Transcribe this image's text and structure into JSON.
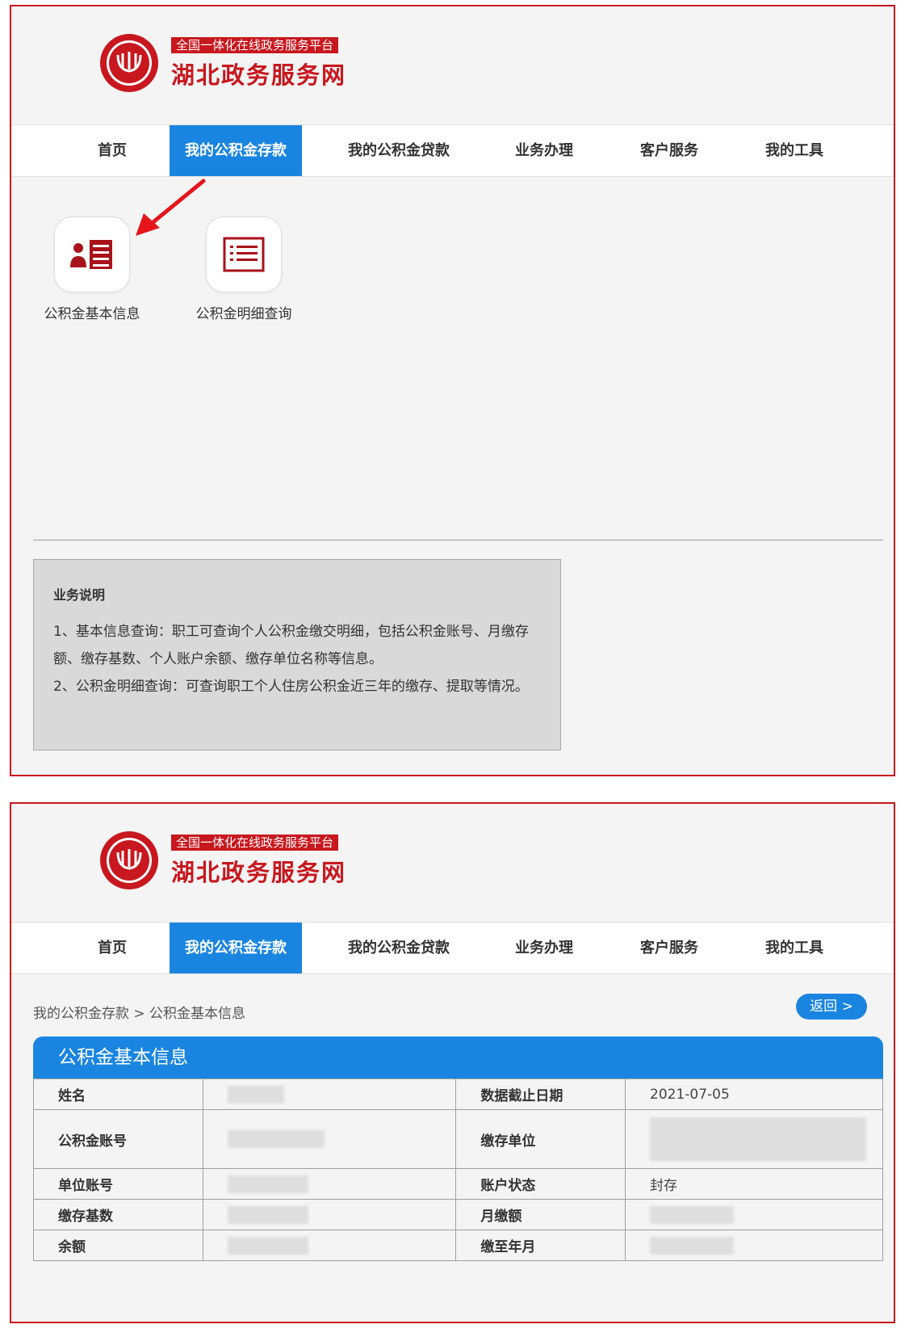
{
  "header": {
    "platform_tag": "全国一体化在线政务服务平台",
    "site_title": "湖北政务服务网"
  },
  "nav": [
    {
      "label": "首页",
      "active": false
    },
    {
      "label": "我的公积金存款",
      "active": true
    },
    {
      "label": "我的公积金贷款",
      "active": false
    },
    {
      "label": "业务办理",
      "active": false
    },
    {
      "label": "客户服务",
      "active": false
    },
    {
      "label": "我的工具",
      "active": false
    }
  ],
  "services": [
    {
      "label": "公积金基本信息",
      "icon": "person-card-icon"
    },
    {
      "label": "公积金明细查询",
      "icon": "list-detail-icon"
    }
  ],
  "notes": {
    "title": "业务说明",
    "line1": "1、基本信息查询：职工可查询个人公积金缴交明细，包括公积金账号、月缴存",
    "line2": "额、缴存基数、个人账户余额、缴存单位名称等信息。",
    "line3": "2、公积金明细查询：可查询职工个人住房公积金近三年的缴存、提取等情况。"
  },
  "detail": {
    "breadcrumb": "我的公积金存款 > 公积金基本信息",
    "back_label": "返回 >",
    "section_title": "公积金基本信息",
    "rows": [
      {
        "l1": "姓名",
        "v1": "",
        "l2": "数据截止日期",
        "v2": "2021-07-05"
      },
      {
        "l1": "公积金账号",
        "v1": "",
        "l2": "缴存单位",
        "v2": ""
      },
      {
        "l1": "单位账号",
        "v1": "",
        "l2": "账户状态",
        "v2": "封存"
      },
      {
        "l1": "缴存基数",
        "v1": "",
        "l2": "月缴额",
        "v2": ""
      },
      {
        "l1": "余额",
        "v1": "",
        "l2": "缴至年月",
        "v2": ""
      }
    ]
  },
  "colors": {
    "brand_red": "#c8171e",
    "nav_blue": "#1a85e0",
    "panel_bg": "#f4f4f4"
  }
}
